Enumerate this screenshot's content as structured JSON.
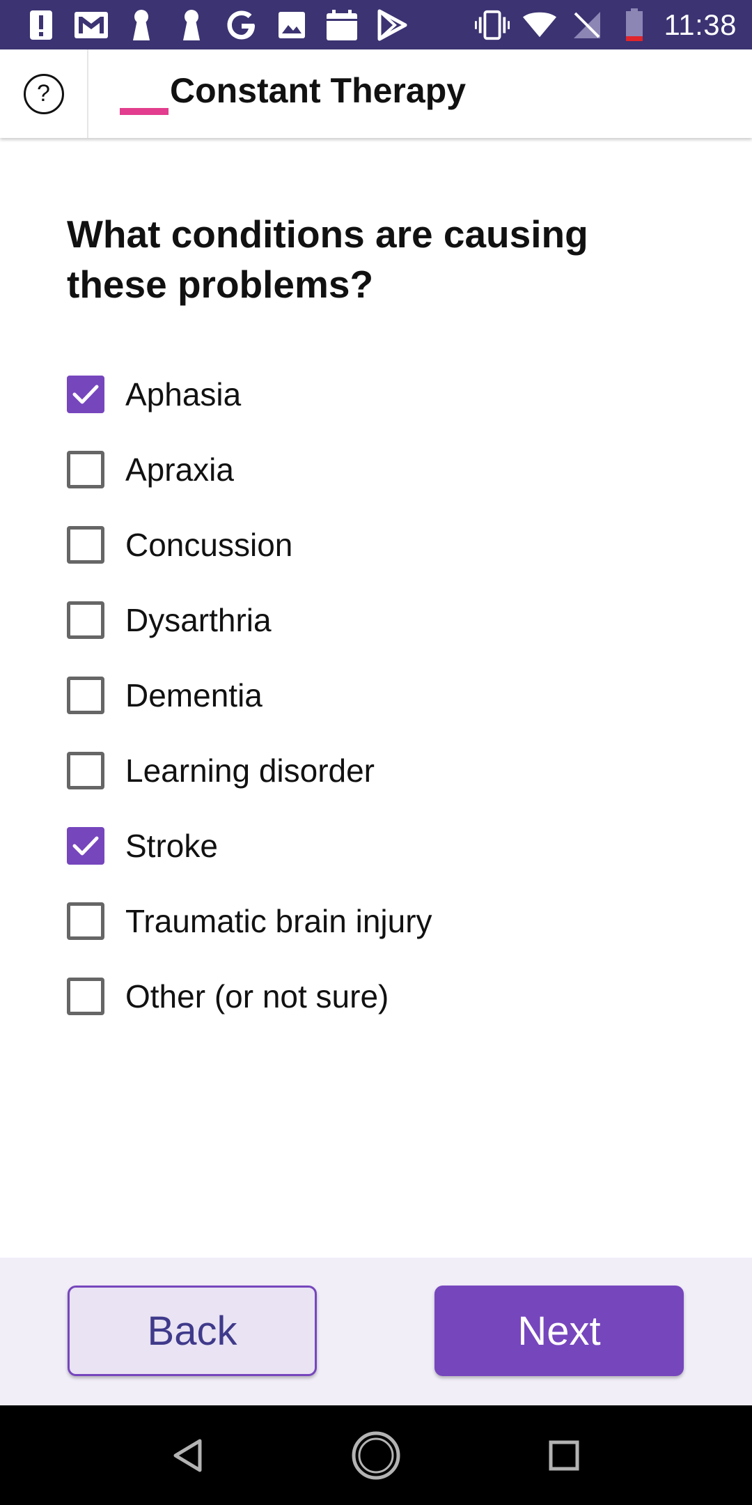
{
  "status_bar": {
    "time": "11:38",
    "left_icons": [
      "alert-icon",
      "gmail-icon",
      "keyhole-icon",
      "keyhole-icon",
      "google-icon",
      "image-icon",
      "calendar-icon",
      "play-store-icon"
    ],
    "right_icons": [
      "vibrate-icon",
      "wifi-icon",
      "no-signal-icon",
      "battery-low-icon"
    ]
  },
  "header": {
    "help_label": "?",
    "app_title": "Constant Therapy",
    "brand_color": "#e23d8e"
  },
  "question": "What conditions are causing these problems?",
  "options": [
    {
      "label": "Aphasia",
      "checked": true
    },
    {
      "label": "Apraxia",
      "checked": false
    },
    {
      "label": "Concussion",
      "checked": false
    },
    {
      "label": "Dysarthria",
      "checked": false
    },
    {
      "label": "Dementia",
      "checked": false
    },
    {
      "label": "Learning disorder",
      "checked": false
    },
    {
      "label": "Stroke",
      "checked": true
    },
    {
      "label": "Traumatic brain injury",
      "checked": false
    },
    {
      "label": "Other (or not sure)",
      "checked": false
    }
  ],
  "actions": {
    "back_label": "Back",
    "next_label": "Next"
  },
  "colors": {
    "accent": "#7646bd",
    "status_bar": "#3b3372",
    "action_bar_bg": "#f1eef8"
  },
  "nav_bar": {
    "items": [
      "back-triangle-icon",
      "home-circle-icon",
      "recents-square-icon"
    ]
  }
}
